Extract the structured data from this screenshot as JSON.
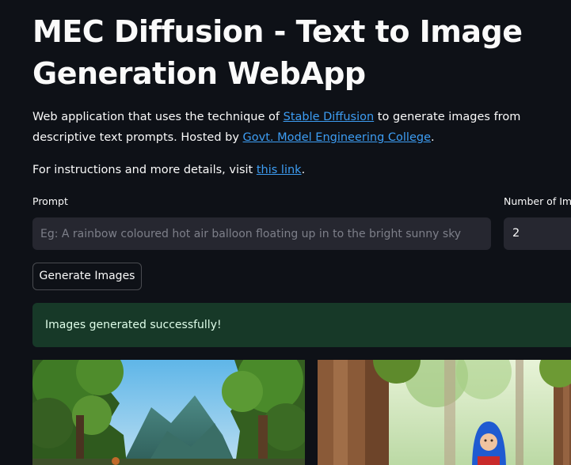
{
  "header": {
    "title": "MEC Diffusion - Text to Image Generation WebApp"
  },
  "description": {
    "part1": "Web application that uses the technique of ",
    "link1": "Stable Diffusion",
    "part2": " to generate images from descriptive text prompts. Hosted by ",
    "link2": "Govt. Model Engineering College",
    "part3": "."
  },
  "instructions": {
    "prefix": "For instructions and more details, visit ",
    "link": "this link",
    "suffix": "."
  },
  "form": {
    "prompt_label": "Prompt",
    "prompt_placeholder": "Eg: A rainbow coloured hot air balloon floating up in to the bright sunny sky",
    "prompt_value": "",
    "count_label": "Number of Images",
    "count_value": "2",
    "generate_label": "Generate Images"
  },
  "status": {
    "message": "Images generated successfully!"
  },
  "results": {
    "images": [
      {
        "icon": "generated-forest-landscape-image"
      },
      {
        "icon": "generated-forest-child-image"
      }
    ]
  },
  "colors": {
    "background": "#0e1117",
    "input_bg": "#262730",
    "link": "#3d9df3",
    "success_bg": "#173928"
  }
}
